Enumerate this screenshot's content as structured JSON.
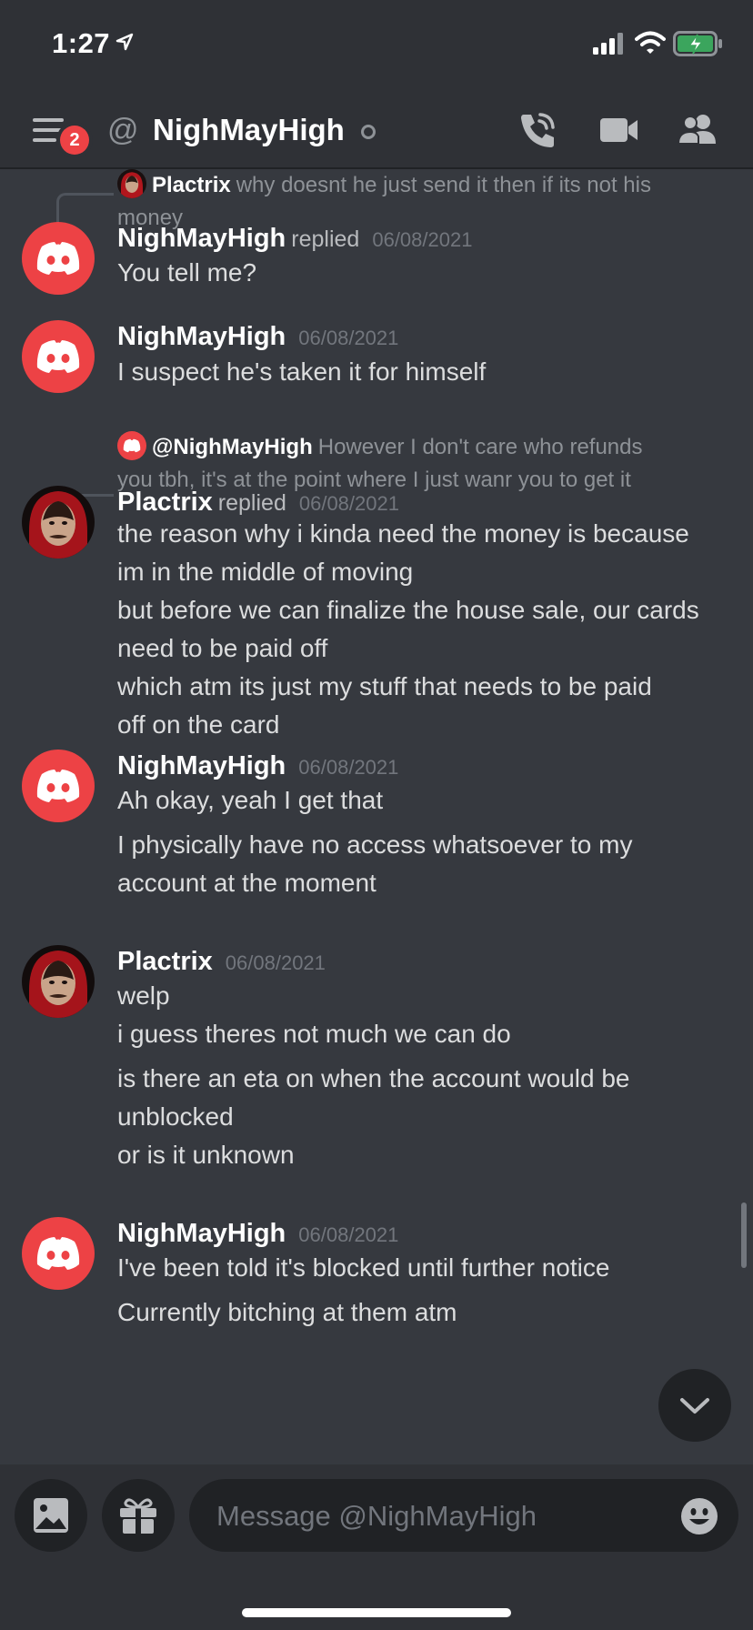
{
  "status_bar": {
    "time": "1:27"
  },
  "header": {
    "badge_count": "2",
    "at_symbol": "@",
    "title": "NighMayHigh"
  },
  "messages": [
    {
      "reply": {
        "user": "Plactrix",
        "line1": "why doesnt he just send it then if its not his",
        "line2": "money"
      },
      "user": "NighMayHigh",
      "replied_label": "replied",
      "timestamp": "06/08/2021",
      "lines": [
        "You tell me?"
      ]
    },
    {
      "user": "NighMayHigh",
      "timestamp": "06/08/2021",
      "lines": [
        "I suspect he's taken it for himself"
      ]
    },
    {
      "reply": {
        "user": "@NighMayHigh",
        "line1": "However I don't care who refunds",
        "line2": "you tbh, it's at the point where I just wanr you to get it"
      },
      "user": "Plactrix",
      "replied_label": "replied",
      "timestamp": "06/08/2021",
      "lines": [
        "the reason why i kinda need the money is because",
        "im in the middle of moving",
        "but before we can finalize the house sale, our cards",
        "need to be paid off",
        "which atm its just my stuff that needs to be paid",
        "off on the card"
      ]
    },
    {
      "user": "NighMayHigh",
      "timestamp": "06/08/2021",
      "lines": [
        "Ah okay, yeah I get that",
        "I physically have no access whatsoever to my",
        "account at the moment"
      ]
    },
    {
      "user": "Plactrix",
      "timestamp": "06/08/2021",
      "lines": [
        "welp",
        "i guess theres not much we can do",
        "is there an eta on when the account would be",
        "unblocked",
        "or is it unknown"
      ]
    },
    {
      "user": "NighMayHigh",
      "timestamp": "06/08/2021",
      "lines": [
        "I've been told it's blocked until further notice",
        "Currently bitching at them atm"
      ]
    }
  ],
  "composer": {
    "placeholder": "Message @NighMayHigh"
  },
  "icons": {
    "header": [
      "menu-icon",
      "at-icon",
      "phone-call-icon",
      "video-camera-icon",
      "members-icon"
    ],
    "composer": [
      "image-icon",
      "gift-icon",
      "emoji-icon"
    ],
    "other": [
      "chevron-down-icon",
      "discord-logo-icon"
    ]
  },
  "colors": {
    "background": "#36393f",
    "header_background": "#2f3136",
    "input_background": "#202225",
    "discord_red_avatar": "#ed4245",
    "badge": "#ed4245",
    "battery_charging": "#3ba55d"
  }
}
